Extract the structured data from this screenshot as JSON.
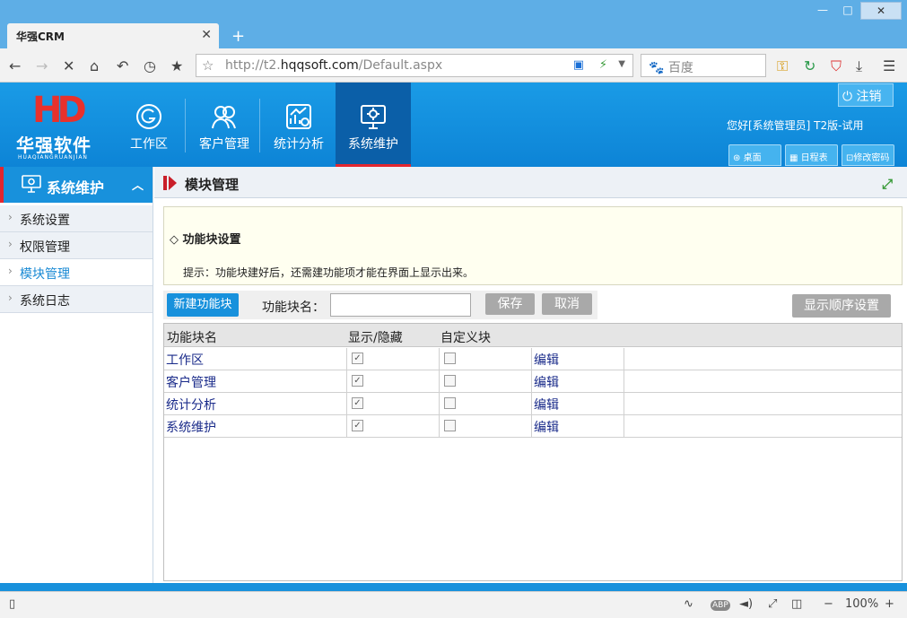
{
  "browser": {
    "tab_title": "华强CRM",
    "tab_close": "✕",
    "new_tab": "+",
    "url_prefix": "http://t2.",
    "url_domain": "hqqsoft.com",
    "url_path": "/Default.aspx",
    "search_placeholder": "百度",
    "zoom": "100%",
    "zoom_minus": "−",
    "zoom_plus": "+"
  },
  "header": {
    "logo_mark": "HD",
    "logo_name": "华强软件",
    "logo_pinyin": "HUAQIANGRUANJIAN",
    "nav": [
      {
        "label": "工作区",
        "icon": "g-circle-icon"
      },
      {
        "label": "客户管理",
        "icon": "users-icon"
      },
      {
        "label": "统计分析",
        "icon": "chart-gear-icon"
      },
      {
        "label": "系统维护",
        "icon": "monitor-gear-icon"
      }
    ],
    "logout_label": "注销",
    "greeting": "您好[系统管理员] T2版-试用",
    "buttons": [
      "桌面",
      "日程表",
      "修改密码"
    ]
  },
  "sidebar": {
    "title": "系统维护",
    "items": [
      "系统设置",
      "权限管理",
      "模块管理",
      "系统日志"
    ],
    "active_index": 2
  },
  "main": {
    "title": "模块管理",
    "notice_heading": "◇ 功能块设置",
    "notice_text": "提示：功能块建好后，还需建功能项才能在界面上显示出来。",
    "new_button": "新建功能块",
    "name_label": "功能块名：",
    "name_value": "",
    "save_button": "保存",
    "cancel_button": "取消",
    "order_button": "显示顺序设置",
    "columns": [
      "功能块名",
      "显示/隐藏",
      "自定义块"
    ],
    "rows": [
      {
        "name": "工作区",
        "visible": true,
        "custom": false,
        "edit": "编辑"
      },
      {
        "name": "客户管理",
        "visible": true,
        "custom": false,
        "edit": "编辑"
      },
      {
        "name": "统计分析",
        "visible": true,
        "custom": false,
        "edit": "编辑"
      },
      {
        "name": "系统维护",
        "visible": true,
        "custom": false,
        "edit": "编辑"
      }
    ]
  },
  "colors": {
    "header_blue": "#1891dc",
    "accent_red": "#e3262f",
    "active_nav": "#0b5fa8",
    "link_blue": "#1a2b8a"
  }
}
